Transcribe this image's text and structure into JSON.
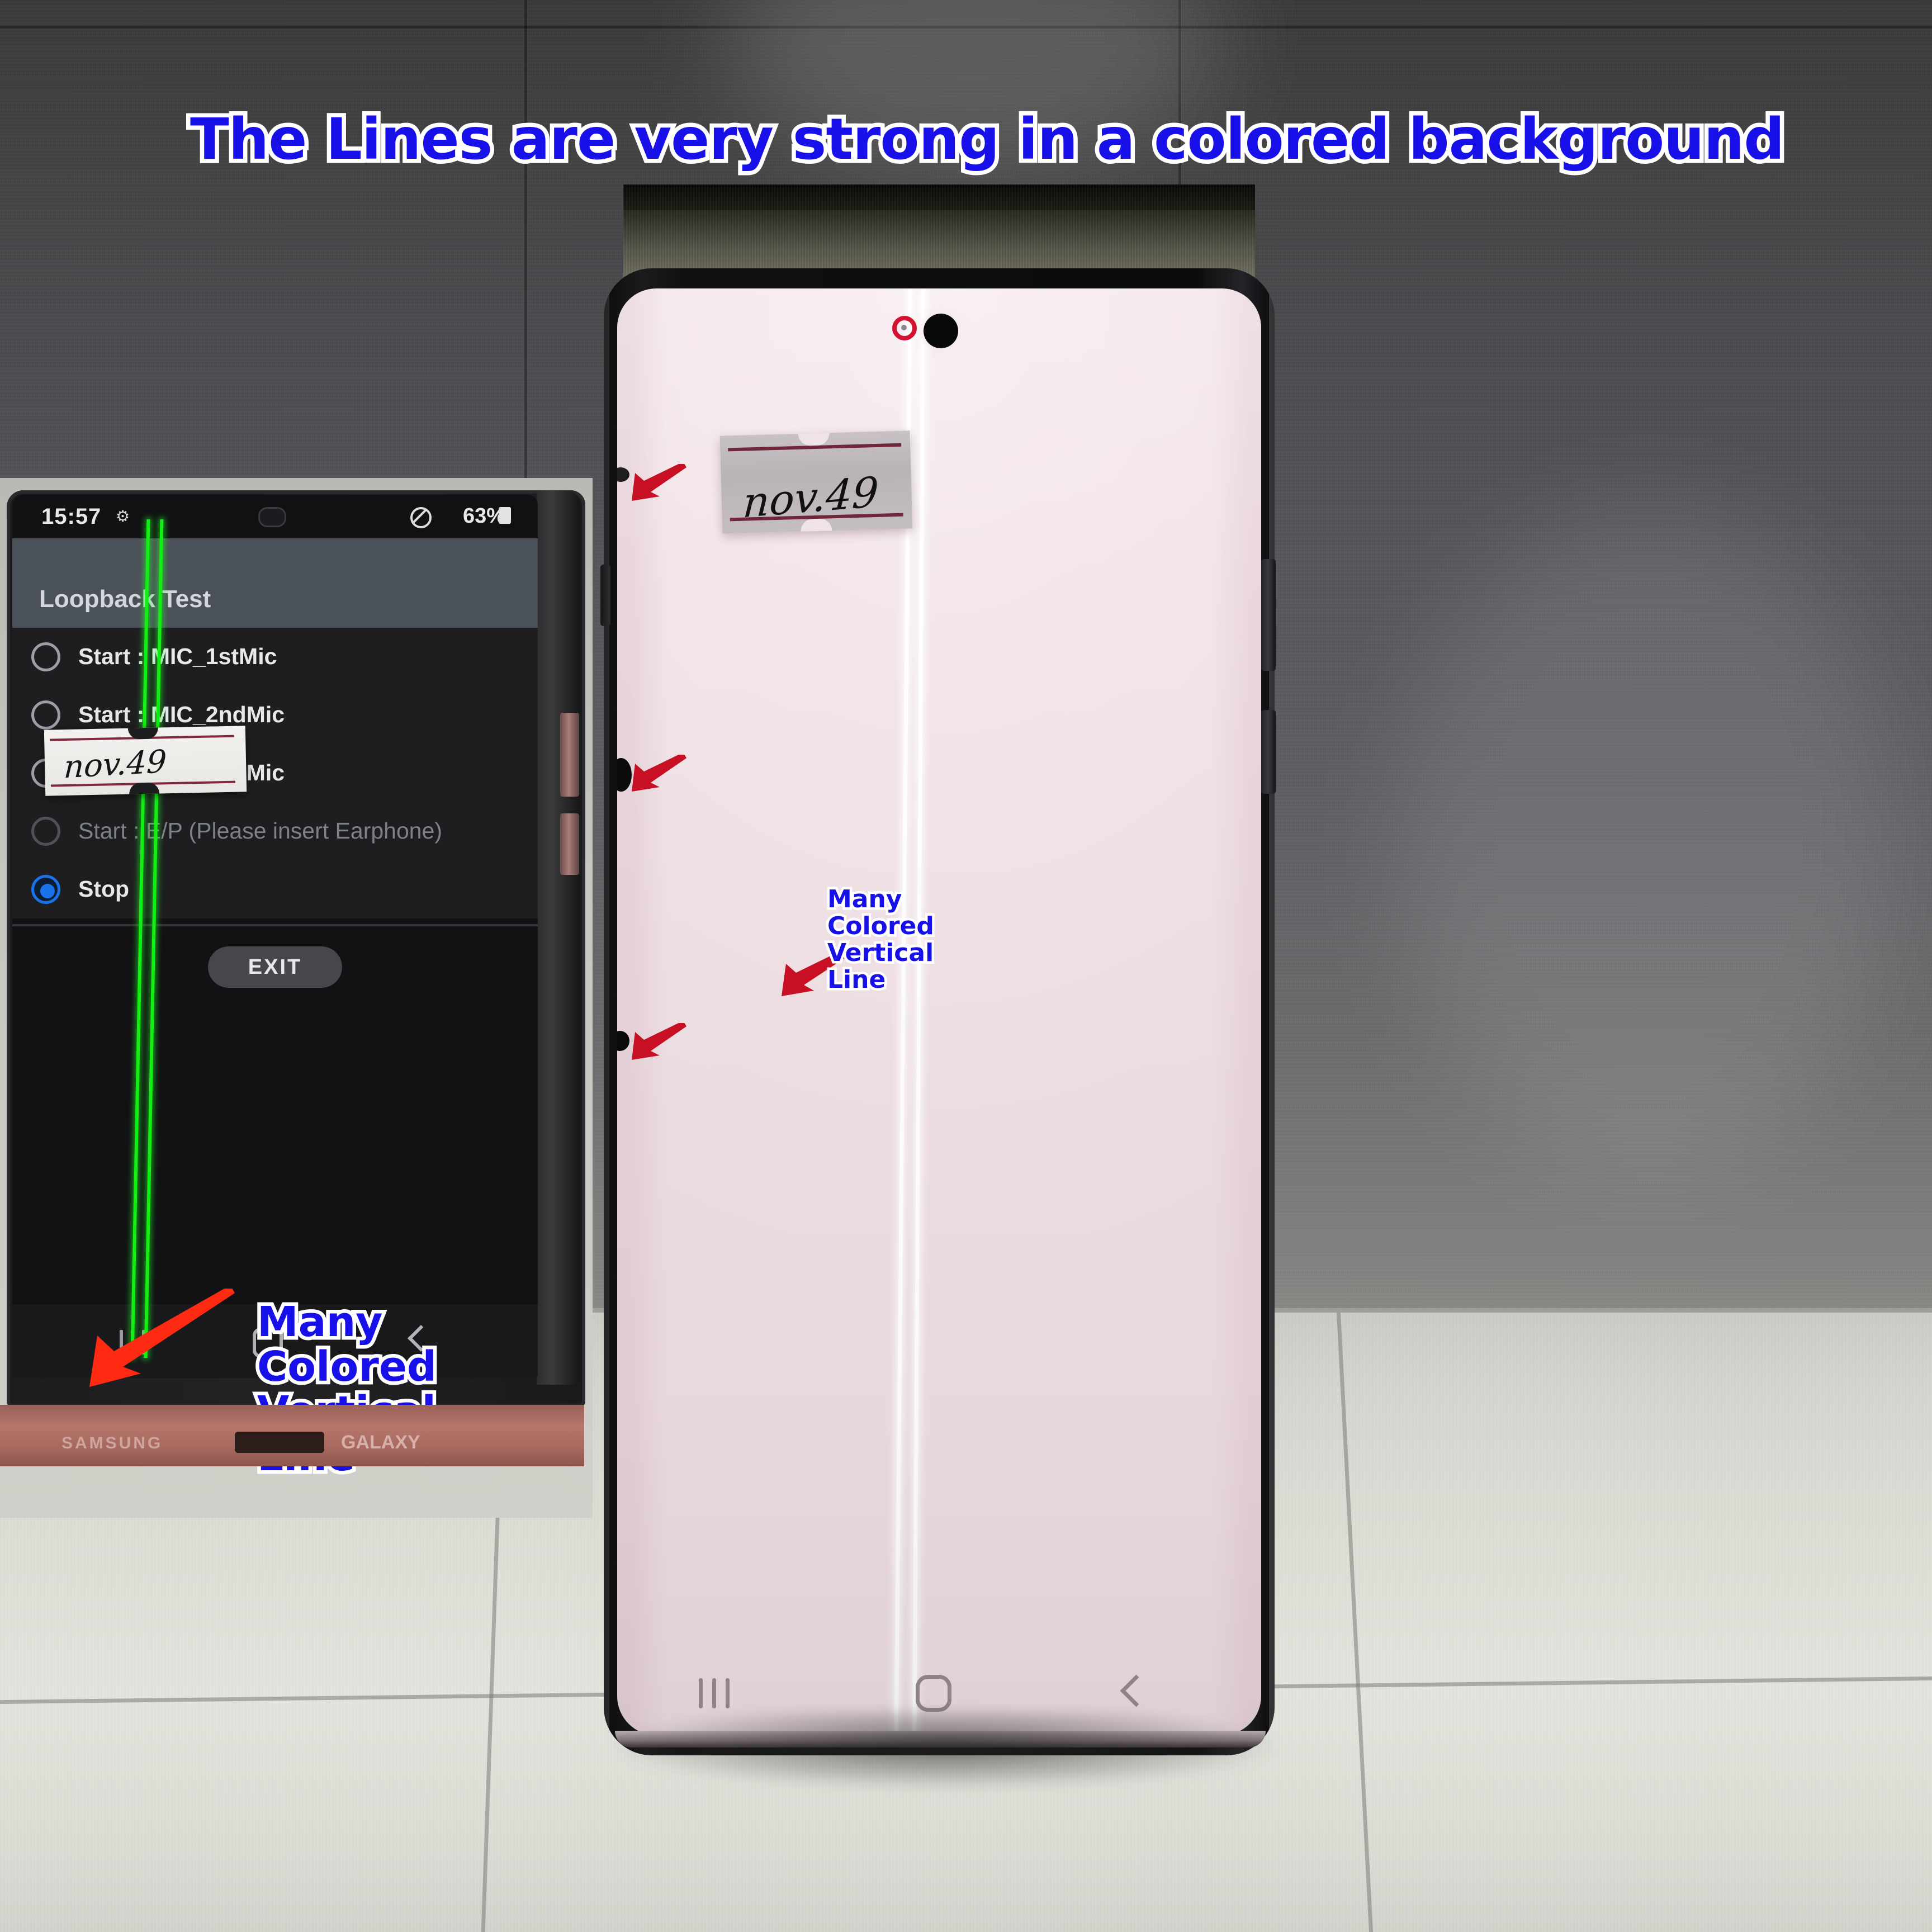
{
  "title": "The Lines are very strong in a colored background",
  "inset_photo": {
    "status_bar": {
      "time": "15:57",
      "gear_icon": "gear-icon",
      "mute_icon": "mute-icon",
      "battery_percent": "63%",
      "battery_icon": "battery-icon"
    },
    "app_title": "Loopback Test",
    "options": [
      {
        "label": "Start : MIC_1stMic",
        "selected": false,
        "dimmed": false
      },
      {
        "label": "Start : MIC_2ndMic",
        "selected": false,
        "dimmed": false
      },
      {
        "label": "Start : SPK_3rdMic",
        "selected": false,
        "dimmed": false
      },
      {
        "label": "Start : E/P (Please insert Earphone)",
        "selected": false,
        "dimmed": true
      },
      {
        "label": "Stop",
        "selected": true,
        "dimmed": false
      }
    ],
    "exit_label": "EXIT",
    "nav": {
      "recents": "recents-icon",
      "home": "home-icon",
      "back": "back-icon"
    },
    "sticky_note_text": "nov.49",
    "box_text_left": "SAMSUNG",
    "box_text_right": "GALAXY",
    "annotation_lines": [
      "Many",
      "Colored",
      "Vertical",
      "Line"
    ],
    "defect_color": "#12f012"
  },
  "main_photo": {
    "sticky_note_text": "nov.49",
    "annotation_lines": [
      "Many",
      "Colored",
      "Vertical",
      "Line"
    ],
    "nav": {
      "recents": "recents-icon",
      "home": "home-icon",
      "back": "back-icon"
    },
    "defect_color": "#fffdfe",
    "screen_color": "#f2e4e8",
    "arrow_color": "#c81025",
    "defect_ring_color": "#d2122e",
    "arrow_count": 3
  },
  "colors": {
    "annotation_blue": "#1810e8",
    "annotation_outline": "#ffffff",
    "red_arrow_bright": "#ff2a12",
    "red_arrow_dark": "#c81025",
    "green_line": "#12f012"
  }
}
